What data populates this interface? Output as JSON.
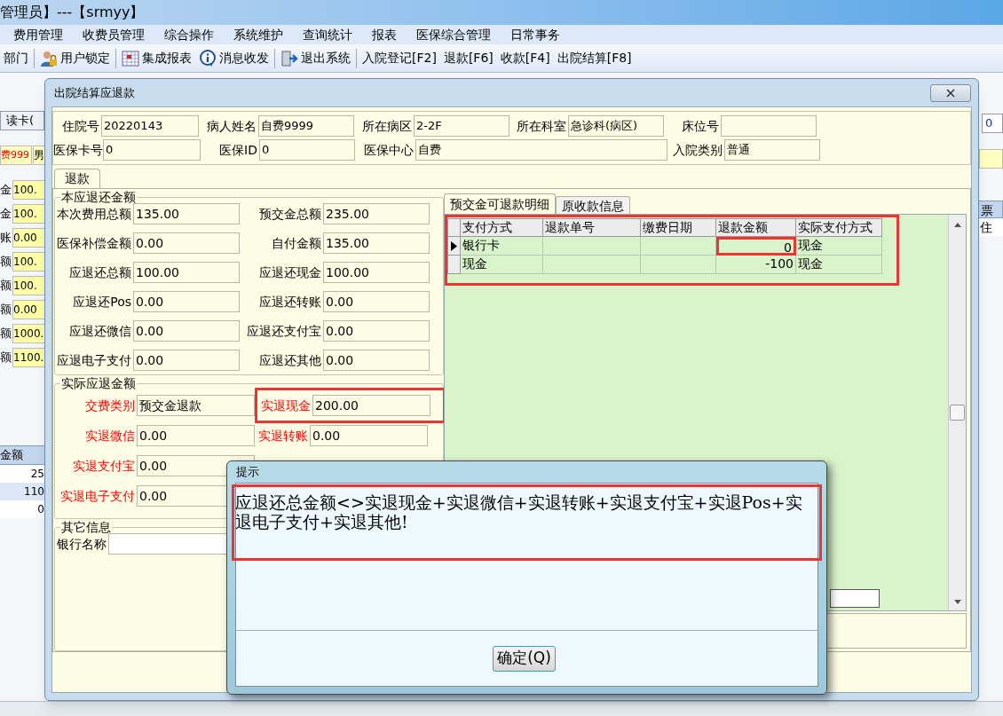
{
  "app": {
    "title": "管理员】---【srmyy】"
  },
  "menu": [
    "费用管理",
    "收费员管理",
    "综合操作",
    "系统维护",
    "查询统计",
    "报表",
    "医保综合管理",
    "日常事务"
  ],
  "toolbar": [
    {
      "label": "部门",
      "kind": "text",
      "separator_after": true
    },
    {
      "label": "用户锁定",
      "kind": "user-lock",
      "separator_after": true
    },
    {
      "label": "集成报表",
      "kind": "report",
      "separator_after": false
    },
    {
      "label": "消息收发",
      "kind": "info",
      "separator_after": true
    },
    {
      "label": "退出系统",
      "kind": "exit",
      "separator_after": true
    },
    {
      "label": "入院登记[F2]",
      "kind": "text",
      "separator_after": false
    },
    {
      "label": "退款[F6]",
      "kind": "text",
      "separator_after": false
    },
    {
      "label": "收款[F4]",
      "kind": "text",
      "separator_after": false
    },
    {
      "label": "出院结算[F8]",
      "kind": "text",
      "separator_after": false
    }
  ],
  "background_left": {
    "read_card": "读卡(",
    "name": "费999",
    "sex": "男",
    "rows": [
      {
        "label": "金",
        "value": "100."
      },
      {
        "label": "金",
        "value": "100."
      },
      {
        "label": "账",
        "value": "0.00"
      },
      {
        "label": "额",
        "value": "100."
      },
      {
        "label": "额",
        "value": "100."
      },
      {
        "label": "额",
        "value": "0.00"
      },
      {
        "label": "额",
        "value": "1000."
      },
      {
        "label": "额",
        "value": "1100."
      }
    ],
    "table_header": "金额",
    "table_rows": [
      {
        "value": "25",
        "selected": false
      },
      {
        "value": "110",
        "selected": true
      },
      {
        "value": "0",
        "selected": false
      }
    ]
  },
  "background_right": {
    "field": "0",
    "header": "票",
    "row": "住"
  },
  "dialog": {
    "title": "出院结算应退款",
    "header_rows": [
      [
        {
          "label": "住院号",
          "value": "20220143"
        },
        {
          "label": "病人姓名",
          "value": "自费9999"
        },
        {
          "label": "所在病区",
          "value": "2-2F"
        },
        {
          "label": "所在科室",
          "value": "急诊科(病区)"
        },
        {
          "label": "床位号"
        }
      ],
      [
        {
          "label": "医保卡号",
          "value": "0"
        },
        {
          "label": "医保ID",
          "value": "0"
        },
        {
          "label": "医保中心",
          "value": "自费"
        },
        {
          "label": "入院类别",
          "value": "普通"
        }
      ]
    ],
    "tab": "退款",
    "due_group": {
      "title": "本应退还金额",
      "rows": [
        [
          {
            "label": "本次费用总额",
            "value": "135.00"
          },
          {
            "label": "预交金总额",
            "value": "235.00"
          }
        ],
        [
          {
            "label": "医保补偿金额",
            "value": "0.00"
          },
          {
            "label": "自付金额",
            "value": "135.00"
          }
        ],
        [
          {
            "label": "应退还总额",
            "value": "100.00"
          },
          {
            "label": "应退还现金",
            "value": "100.00"
          }
        ],
        [
          {
            "label": "应退还Pos",
            "value": "0.00"
          },
          {
            "label": "应退还转账",
            "value": "0.00"
          }
        ],
        [
          {
            "label": "应退还微信",
            "value": "0.00"
          },
          {
            "label": "应退还支付宝",
            "value": "0.00"
          }
        ],
        [
          {
            "label": "应退电子支付",
            "value": "0.00"
          },
          {
            "label": "应退还其他",
            "value": "0.00"
          }
        ]
      ]
    },
    "actual_group": {
      "title": "实际应退金额",
      "rows": [
        [
          {
            "label": "交费类别",
            "value": "预交金退款"
          },
          {
            "label": "实退现金",
            "value": "200.00",
            "highlighted": true
          }
        ],
        [
          {
            "label": "实退微信",
            "value": "0.00"
          },
          {
            "label": "实退转账",
            "value": "0.00"
          }
        ],
        [
          {
            "label": "实退支付宝",
            "value": "0.00"
          }
        ],
        [
          {
            "label": "实退电子支付",
            "value": "0.00"
          }
        ]
      ]
    },
    "other_group": {
      "title": "其它信息",
      "rows": [
        [
          {
            "label": "银行名称"
          }
        ]
      ]
    },
    "detail_tabs": [
      {
        "label": "预交金可退款明细",
        "selected": true
      },
      {
        "label": "原收款信息",
        "selected": false
      }
    ],
    "grid": {
      "highlighted": true,
      "columns": [
        "支付方式",
        "退款单号",
        "缴费日期",
        "退款金额",
        "实际支付方式"
      ],
      "rows": [
        {
          "current": true,
          "amount_highlighted": true,
          "pay_method": "银行卡",
          "amount": "0",
          "actual_method": "现金"
        },
        {
          "current": false,
          "amount_highlighted": false,
          "pay_method": "现金",
          "amount": "-100",
          "actual_method": "现金"
        }
      ]
    }
  },
  "message": {
    "title": "提示",
    "highlighted": true,
    "text": "应退还总金额<>实退现金+实退微信+实退转账+实退支付宝+实退Pos+实退电子支付+实退其他!",
    "button": "确定(Q)"
  }
}
